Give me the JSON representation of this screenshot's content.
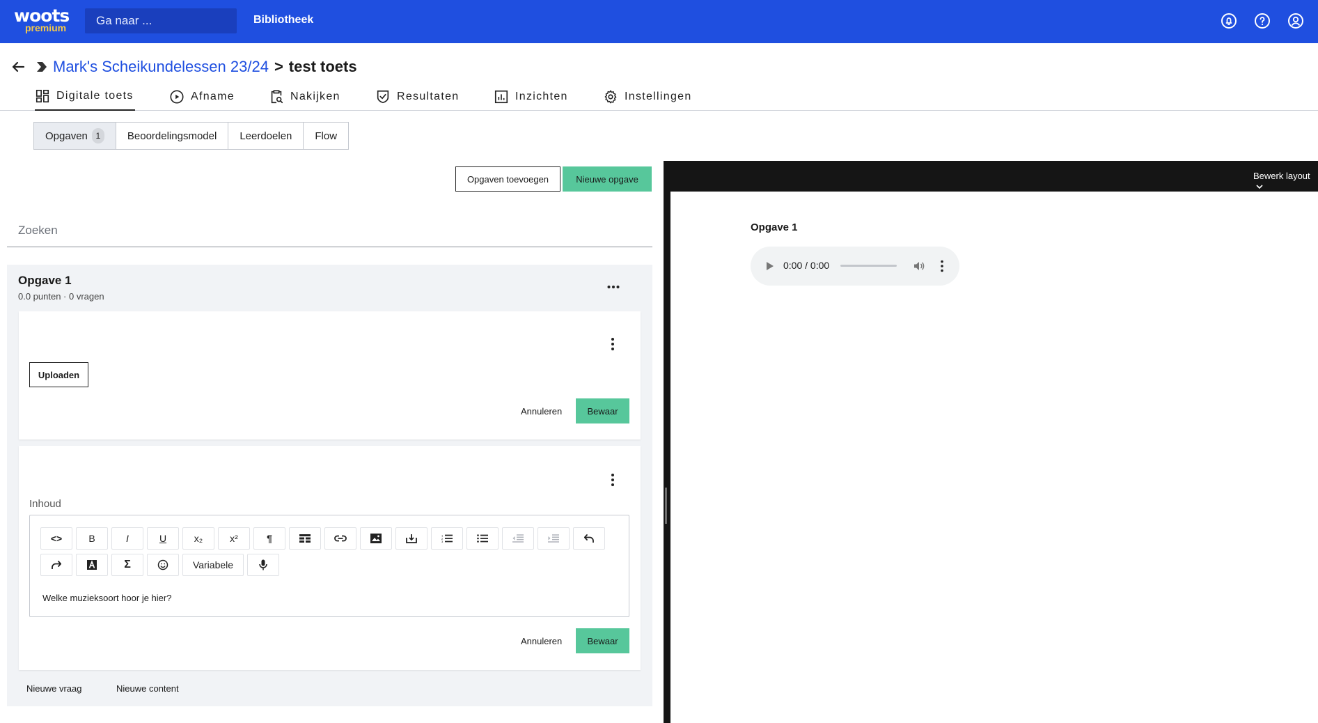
{
  "topbar": {
    "logo_text": "woots",
    "logo_sub": "premium",
    "search_placeholder": "Ga naar ...",
    "library_link": "Bibliotheek",
    "icons": [
      "notification-icon",
      "help-icon",
      "account-icon"
    ]
  },
  "breadcrumb": {
    "course": "Mark's Scheikundelessen 23/24",
    "separator": ">",
    "current": "test toets"
  },
  "tabs": [
    {
      "label": "Digitale toets",
      "icon": "grid-icon",
      "active": true
    },
    {
      "label": "Afname",
      "icon": "play-icon",
      "active": false
    },
    {
      "label": "Nakijken",
      "icon": "clipboard-search-icon",
      "active": false
    },
    {
      "label": "Resultaten",
      "icon": "shield-check-icon",
      "active": false
    },
    {
      "label": "Inzichten",
      "icon": "chart-icon",
      "active": false
    },
    {
      "label": "Instellingen",
      "icon": "gear-icon",
      "active": false
    }
  ],
  "subtabs": [
    {
      "label": "Opgaven",
      "count": "1",
      "active": true
    },
    {
      "label": "Beoordelingsmodel"
    },
    {
      "label": "Leerdoelen"
    },
    {
      "label": "Flow"
    }
  ],
  "actions": {
    "add_label": "Opgaven toevoegen",
    "new_label": "Nieuwe opgave"
  },
  "search": {
    "placeholder": "Zoeken"
  },
  "opgave": {
    "title": "Opgave 1",
    "meta": "0.0 punten · 0 vragen"
  },
  "upload_card": {
    "upload_label": "Uploaden",
    "cancel_label": "Annuleren",
    "save_label": "Bewaar"
  },
  "content_card": {
    "field_label": "Inhoud",
    "toolbar_row1": [
      "<>",
      "B",
      "I",
      "U",
      "x₂",
      "x²",
      "¶",
      "table",
      "link",
      "image",
      "embed",
      "ordered-list",
      "bullet-list",
      "outdent",
      "indent",
      "undo"
    ],
    "toolbar_row2": [
      "redo",
      "text-color",
      "Σ",
      "emoji",
      "Variabele",
      "mic"
    ],
    "text": "Welke muzieksoort hoor je hier?",
    "cancel_label": "Annuleren",
    "save_label": "Bewaar"
  },
  "footer_actions": {
    "new_question": "Nieuwe vraag",
    "new_content": "Nieuwe content"
  },
  "preview": {
    "layout_button": "Bewerk layout",
    "title": "Opgave 1",
    "audio_time": "0:00 / 0:00"
  },
  "colors": {
    "brand_blue": "#1f4fe0",
    "accent_green": "#57c79b",
    "logo_yellow": "#f4c84a",
    "dark_pane": "#151515"
  }
}
